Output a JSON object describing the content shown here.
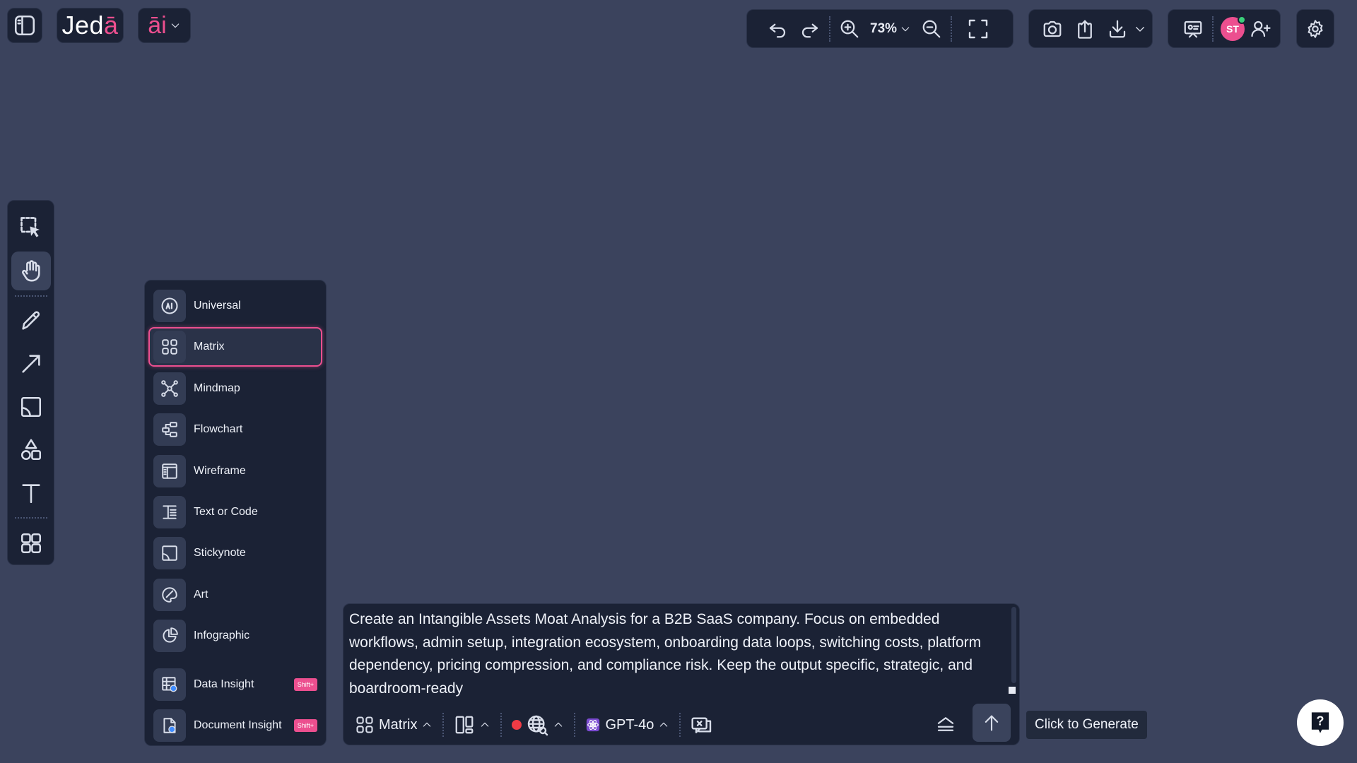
{
  "header": {
    "logo_text": "Jed",
    "logo_accent": "ā",
    "ai_label": "āi"
  },
  "toolbar": {
    "zoom": "73%",
    "avatar_initials": "ST"
  },
  "template_menu": {
    "items": [
      {
        "label": "Universal",
        "icon": "ai-circle-icon"
      },
      {
        "label": "Matrix",
        "icon": "matrix-grid-icon",
        "selected": true
      },
      {
        "label": "Mindmap",
        "icon": "mindmap-icon"
      },
      {
        "label": "Flowchart",
        "icon": "flowchart-icon"
      },
      {
        "label": "Wireframe",
        "icon": "wireframe-icon"
      },
      {
        "label": "Text or Code",
        "icon": "text-code-icon"
      },
      {
        "label": "Stickynote",
        "icon": "stickynote-icon"
      },
      {
        "label": "Art",
        "icon": "art-palette-icon"
      },
      {
        "label": "Infographic",
        "icon": "pie-chart-icon"
      }
    ],
    "extra_items": [
      {
        "label": "Data Insight",
        "badge": "Shift+",
        "icon": "data-insight-icon"
      },
      {
        "label": "Document Insight",
        "badge": "Shift+",
        "icon": "document-insight-icon"
      }
    ]
  },
  "prompt": {
    "text": "Create an Intangible Assets Moat Analysis for a B2B SaaS company. Focus on embedded workflows, admin setup, integration ecosystem, onboarding data loops, switching costs, platform dependency, pricing compression, and compliance risk. Keep the output specific, strategic, and boardroom-ready",
    "mode_label": "Matrix",
    "model_label": "GPT-4o"
  },
  "tooltip": "Click to Generate",
  "colors": {
    "accent": "#ec4f8f",
    "canvas_bg": "#3b435d",
    "panel_bg": "#1b2235"
  }
}
